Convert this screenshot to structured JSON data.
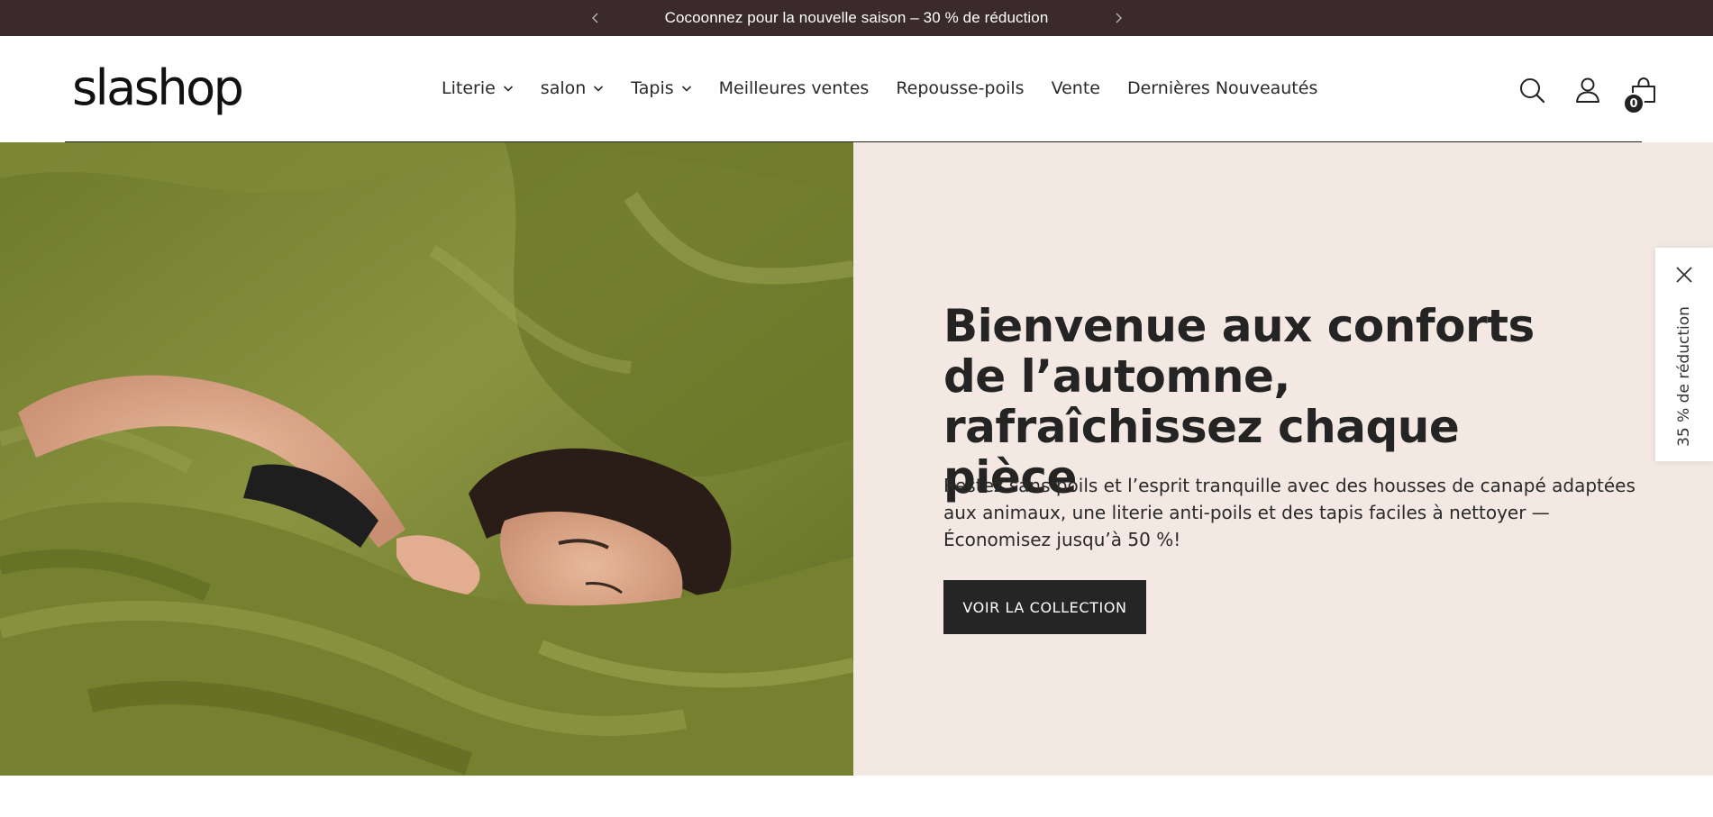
{
  "announcement": {
    "text": "Cocoonnez pour la nouvelle saison – 30 % de réduction"
  },
  "header": {
    "logo_text": "slashop",
    "nav": [
      {
        "label": "Literie",
        "has_dropdown": true
      },
      {
        "label": "salon",
        "has_dropdown": true
      },
      {
        "label": "Tapis",
        "has_dropdown": true
      },
      {
        "label": "Meilleures ventes",
        "has_dropdown": false
      },
      {
        "label": "Repousse-poils",
        "has_dropdown": false
      },
      {
        "label": "Vente",
        "has_dropdown": false
      },
      {
        "label": "Dernières Nouveautés",
        "has_dropdown": false
      }
    ],
    "icons": [
      "search-icon",
      "account-icon",
      "cart-icon"
    ],
    "cart_count": "0"
  },
  "hero": {
    "image_subject": "woman lying under olive green bedding",
    "title": "Bienvenue aux conforts de l’automne, rafraîchissez chaque pièce",
    "body": "Restez sans poils et l’esprit tranquille avec des housses de canapé adaptées aux animaux, une literie anti-poils et des tapis faciles à nettoyer — Économisez jusqu’à 50 %!",
    "cta_label": "VOIR LA COLLECTION"
  },
  "side_tab": {
    "label": "35 % de réduction"
  },
  "colors": {
    "announcement_bg": "#3a2a2c",
    "hero_panel_bg": "#f4e8e2",
    "cta_bg": "#252525",
    "bedding_green": "#75802f"
  }
}
